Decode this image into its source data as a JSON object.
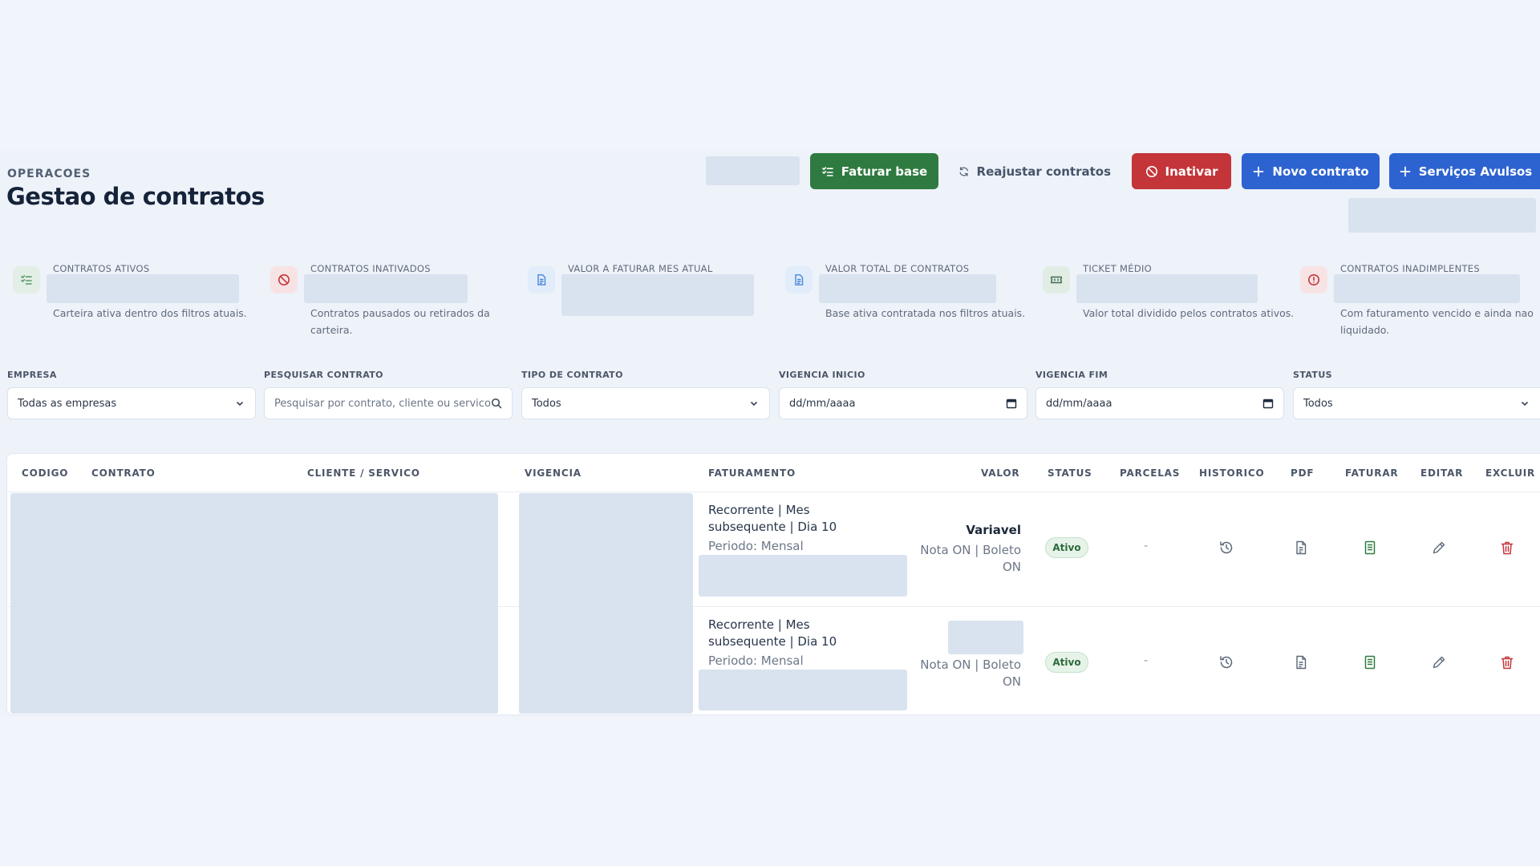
{
  "header": {
    "eyebrow": "OPERACOES",
    "title": "Gestao de contratos"
  },
  "actions": {
    "faturar_base": "Faturar base",
    "reajustar": "Reajustar contratos",
    "inativar": "Inativar",
    "novo_contrato": "Novo contrato",
    "servicos_avulsos": "Serviços Avulsos"
  },
  "kpis": [
    {
      "label": "CONTRATOS ATIVOS",
      "desc": "Carteira ativa dentro dos filtros atuais.",
      "icon": "checklist-icon",
      "color": "#5a9b6a"
    },
    {
      "label": "CONTRATOS INATIVADOS",
      "desc": "Contratos pausados ou retirados da carteira.",
      "icon": "ban-icon",
      "color": "#c4353a"
    },
    {
      "label": "VALOR A FATURAR MES ATUAL",
      "desc": "",
      "icon": "document-icon",
      "color": "#4a86d8"
    },
    {
      "label": "VALOR TOTAL DE CONTRATOS",
      "desc": "Base ativa contratada nos filtros atuais.",
      "icon": "document-icon",
      "color": "#4a86d8"
    },
    {
      "label": "TICKET MÉDIO",
      "desc": "Valor total dividido pelos contratos ativos.",
      "icon": "ticket-icon",
      "color": "#3f6b4c"
    },
    {
      "label": "CONTRATOS INADIMPLENTES",
      "desc": "Com faturamento vencido e ainda nao liquidado.",
      "icon": "alert-circle-icon",
      "color": "#c4353a"
    }
  ],
  "filters": {
    "empresa": {
      "label": "EMPRESA",
      "value": "Todas as empresas"
    },
    "pesquisar": {
      "label": "PESQUISAR CONTRATO",
      "placeholder": "Pesquisar por contrato, cliente ou servico"
    },
    "tipo": {
      "label": "TIPO DE CONTRATO",
      "value": "Todos"
    },
    "vigencia_inicio": {
      "label": "VIGENCIA INICIO",
      "value": "dd/mm/aaaa"
    },
    "vigencia_fim": {
      "label": "VIGENCIA FIM",
      "value": "dd/mm/aaaa"
    },
    "status": {
      "label": "STATUS",
      "value": "Todos"
    }
  },
  "table": {
    "columns": {
      "codigo": "CODIGO",
      "contrato": "CONTRATO",
      "cliente": "CLIENTE / SERVICO",
      "vigencia": "VIGENCIA",
      "faturamento": "FATURAMENTO",
      "valor": "VALOR",
      "status": "STATUS",
      "parcelas": "PARCELAS",
      "historico": "HISTORICO",
      "pdf": "PDF",
      "faturar": "FATURAR",
      "editar": "EDITAR",
      "excluir": "EXCLUIR"
    },
    "rows": [
      {
        "faturamento_l1": "Recorrente | Mes",
        "faturamento_l2": "subsequente | Dia 10",
        "periodo": "Periodo: Mensal",
        "valor": "Variavel",
        "nota_l1": "Nota ON | Boleto",
        "nota_l2": "ON",
        "status": "Ativo",
        "parcelas": "-"
      },
      {
        "faturamento_l1": "Recorrente | Mes",
        "faturamento_l2": "subsequente | Dia 10",
        "periodo": "Periodo: Mensal",
        "valor": "",
        "nota_l1": "Nota ON | Boleto",
        "nota_l2": "ON",
        "status": "Ativo",
        "parcelas": "-"
      }
    ]
  },
  "colors": {
    "green": "#2f7a40",
    "red": "#c4353a",
    "blue": "#2d63d0",
    "background": "#f1f4fa"
  }
}
